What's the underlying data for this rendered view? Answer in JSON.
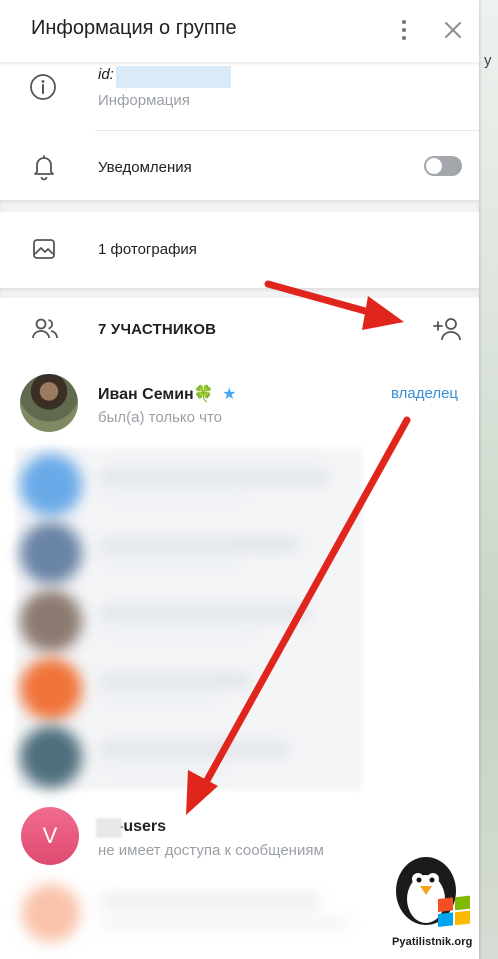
{
  "background": {
    "fragment": "у"
  },
  "header": {
    "title": "Информация о группе"
  },
  "info": {
    "id_label": "id:",
    "subtitle": "Информация"
  },
  "notifications": {
    "label": "Уведомления",
    "enabled": false
  },
  "photos": {
    "label": "1 фотография"
  },
  "members": {
    "label": "7 УЧАСТНИКОВ",
    "owner": {
      "name": "Иван Семин",
      "emoji": "🍀",
      "badge": "★",
      "status": "был(а) только что",
      "role": "владелец"
    },
    "bot": {
      "avatar_letter": "V",
      "name": "-users",
      "status": "не имеет доступа к сообщениям"
    }
  },
  "watermark": {
    "text": "Pyatilistnik.org"
  },
  "colors": {
    "accent": "#3a8fd6",
    "avatar_pink": "#e9577d",
    "arrow_red": "#e0261c"
  }
}
